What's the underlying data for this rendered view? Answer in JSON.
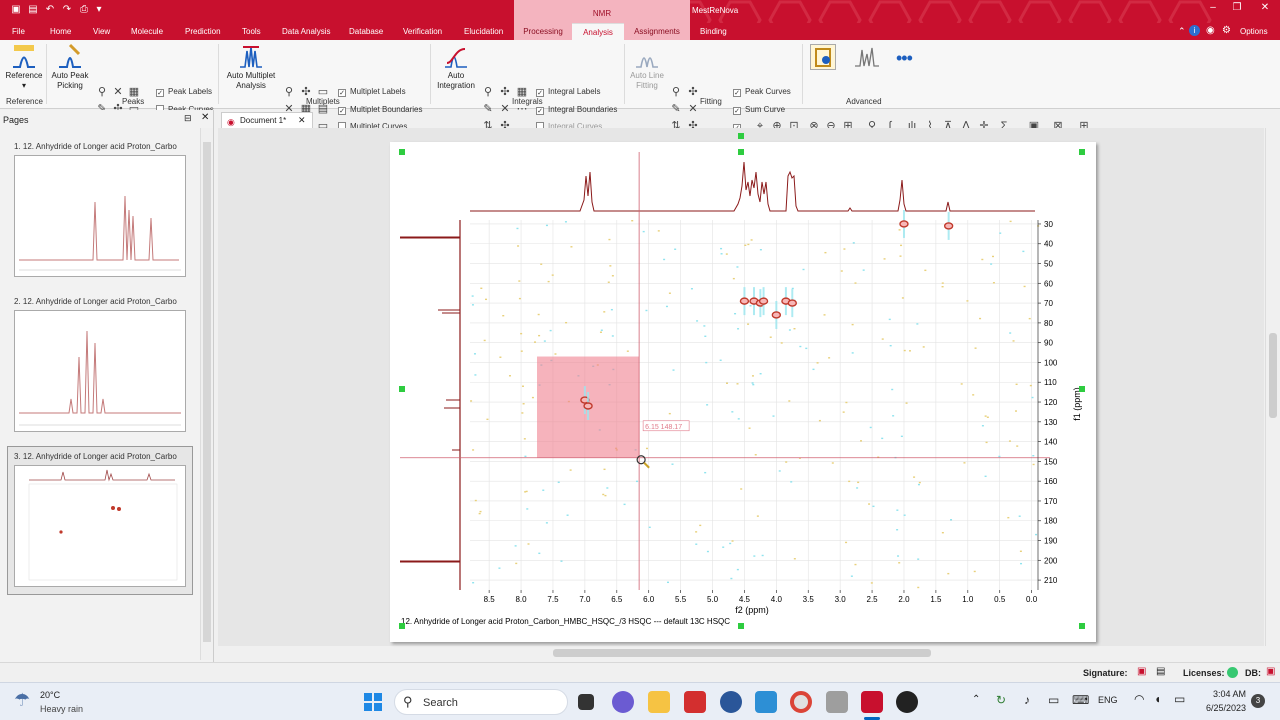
{
  "app": {
    "title": "MestReNova",
    "context_tab": "NMR"
  },
  "menu": {
    "items": [
      "File",
      "Home",
      "View",
      "Molecule",
      "Prediction",
      "Tools",
      "Data Analysis",
      "Database",
      "Verification",
      "Elucidation",
      "Processing",
      "Analysis",
      "Assignments",
      "Binding"
    ],
    "active": "Analysis",
    "right": "Options"
  },
  "ribbon": {
    "reference": {
      "button": "Reference",
      "group": "Reference"
    },
    "peaks": {
      "auto_peak_picking": "Auto Peak Picking",
      "peak_labels": "Peak Labels",
      "peak_curves": "Peak Curves",
      "group": "Peaks"
    },
    "multiplets": {
      "auto": "Auto Multiplet Analysis",
      "labels": "Multiplet Labels",
      "boundaries": "Multiplet Boundaries",
      "curves": "Multiplet Curves",
      "group": "Multiplets"
    },
    "integrals": {
      "auto": "Auto Integration",
      "labels": "Integral Labels",
      "boundaries": "Integral Boundaries",
      "curves": "Integral Curves",
      "group": "Integrals"
    },
    "fitting": {
      "auto_line": "Auto Line Fitting",
      "peak_curves": "Peak Curves",
      "sum_curve": "Sum Curve",
      "group": "Fitting"
    },
    "advanced": {
      "group": "Advanced"
    }
  },
  "pages_panel": {
    "title": "Pages",
    "pages": [
      {
        "caption": "1. 12. Anhydride of Longer acid Proton_Carbo"
      },
      {
        "caption": "2. 12. Anhydride of Longer acid Proton_Carbo"
      },
      {
        "caption": "3. 12. Anhydride of Longer acid Proton_Carbo"
      }
    ]
  },
  "document": {
    "tab": "Document 1*",
    "caption": "12. Anhydride of Longer acid Proton_Carbon_HMBC_HSQC_/3 HSQC --- default 13C HSQC",
    "cursor_readout": "6.15 148.17"
  },
  "chart_data": {
    "type": "heatmap",
    "title": "",
    "xlabel": "f2 (ppm)",
    "ylabel": "f1 (ppm)",
    "xlim": [
      8.8,
      -0.1
    ],
    "ylim": [
      28,
      215
    ],
    "x_ticks": [
      "8.5",
      "8.0",
      "7.5",
      "7.0",
      "6.5",
      "6.0",
      "5.5",
      "5.0",
      "4.5",
      "4.0",
      "3.5",
      "3.0",
      "2.5",
      "2.0",
      "1.5",
      "1.0",
      "0.5",
      "0.0"
    ],
    "y_ticks": [
      "30",
      "40",
      "50",
      "60",
      "70",
      "80",
      "90",
      "100",
      "110",
      "120",
      "130",
      "140",
      "150",
      "160",
      "170",
      "180",
      "190",
      "200",
      "210"
    ],
    "cross_peaks": [
      {
        "x": 7.0,
        "y": 119
      },
      {
        "x": 6.95,
        "y": 122
      },
      {
        "x": 4.5,
        "y": 69
      },
      {
        "x": 4.35,
        "y": 69
      },
      {
        "x": 4.25,
        "y": 70
      },
      {
        "x": 4.2,
        "y": 69
      },
      {
        "x": 4.0,
        "y": 76
      },
      {
        "x": 3.85,
        "y": 69
      },
      {
        "x": 3.75,
        "y": 70
      },
      {
        "x": 2.0,
        "y": 30
      },
      {
        "x": 1.3,
        "y": 31
      }
    ],
    "cursor": {
      "x": 6.15,
      "y": 148.17
    },
    "zoom_box": {
      "x": [
        7.75,
        6.15
      ],
      "y": [
        97,
        148
      ]
    }
  },
  "status": {
    "signature": "Signature:",
    "licenses": "Licenses:",
    "db": "DB:"
  },
  "taskbar": {
    "weather_temp": "20°C",
    "weather_desc": "Heavy rain",
    "search": "Search",
    "lang": "ENG",
    "time": "3:04 AM",
    "date": "6/25/2023",
    "badge": "3"
  },
  "colors": {
    "brand": "#c8102e",
    "zoom_box": "#f08090",
    "spectrum": "#8b1a1a"
  }
}
